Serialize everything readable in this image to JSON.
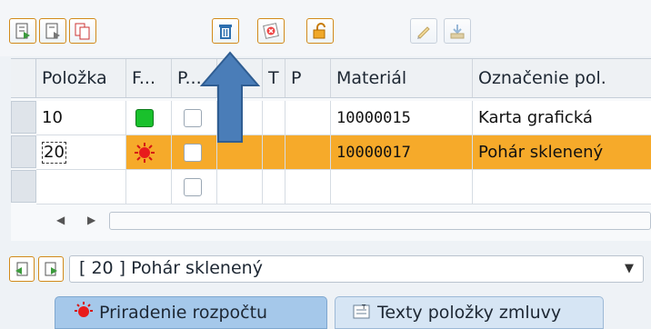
{
  "toolbar": {
    "buttons": [
      {
        "icon": "details-icon"
      },
      {
        "icon": "details-alt-icon"
      },
      {
        "icon": "copy-icon"
      },
      {
        "icon": "trash-icon"
      },
      {
        "icon": "delete-x-icon"
      },
      {
        "icon": "unlock-icon"
      },
      {
        "icon": "pencil-icon"
      },
      {
        "icon": "download-icon"
      }
    ]
  },
  "grid": {
    "columns": [
      "Položka",
      "F...",
      "P...",
      "",
      "T",
      "P",
      "Materiál",
      "Označenie pol."
    ],
    "rows": [
      {
        "item": "10",
        "status": "green",
        "checked": false,
        "material": "10000015",
        "description": "Karta grafická"
      },
      {
        "item": "20",
        "status": "red",
        "checked": false,
        "material": "10000017",
        "description": "Pohár sklenený"
      },
      {
        "item": "",
        "status": "",
        "checked": false,
        "material": "",
        "description": ""
      }
    ]
  },
  "selector": {
    "value": "[ 20 ] Pohár sklenený"
  },
  "tabs": [
    {
      "label": "Priradenie rozpočtu",
      "icon": "red-status-icon"
    },
    {
      "label": "Texty položky zmluvy",
      "icon": "text-document-icon"
    }
  ],
  "colors": {
    "selected_row": "#f6aa2a",
    "accent_border": "#d28a1a",
    "arrow": "#4a7db8"
  }
}
